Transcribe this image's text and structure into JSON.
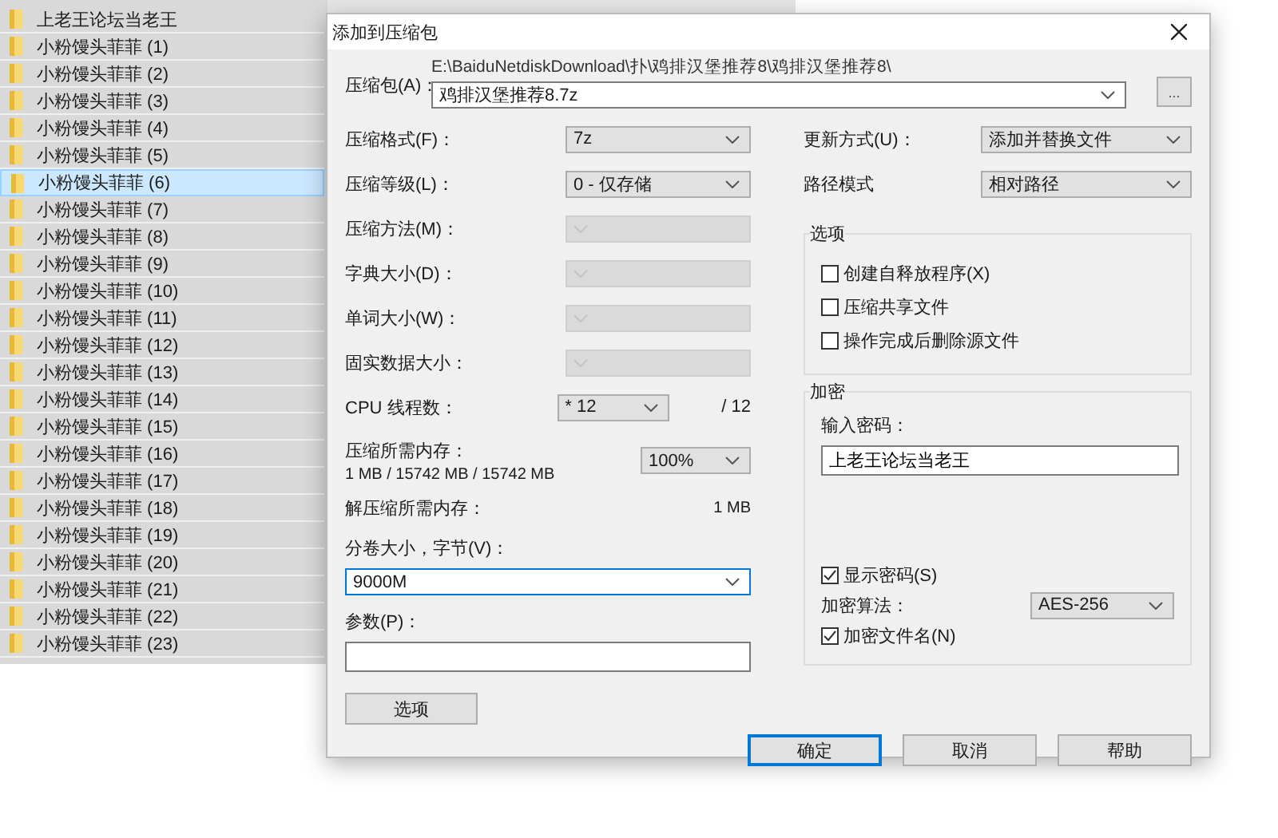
{
  "file_list": {
    "items": [
      {
        "name": "上老王论坛当老王",
        "selected": false
      },
      {
        "name": "小粉馒头菲菲 (1)",
        "selected": false
      },
      {
        "name": "小粉馒头菲菲 (2)",
        "selected": false
      },
      {
        "name": "小粉馒头菲菲 (3)",
        "selected": false
      },
      {
        "name": "小粉馒头菲菲 (4)",
        "selected": false
      },
      {
        "name": "小粉馒头菲菲 (5)",
        "selected": false
      },
      {
        "name": "小粉馒头菲菲 (6)",
        "selected": true
      },
      {
        "name": "小粉馒头菲菲 (7)",
        "selected": false
      },
      {
        "name": "小粉馒头菲菲 (8)",
        "selected": false
      },
      {
        "name": "小粉馒头菲菲 (9)",
        "selected": false
      },
      {
        "name": "小粉馒头菲菲 (10)",
        "selected": false
      },
      {
        "name": "小粉馒头菲菲 (11)",
        "selected": false
      },
      {
        "name": "小粉馒头菲菲 (12)",
        "selected": false
      },
      {
        "name": "小粉馒头菲菲 (13)",
        "selected": false
      },
      {
        "name": "小粉馒头菲菲 (14)",
        "selected": false
      },
      {
        "name": "小粉馒头菲菲 (15)",
        "selected": false
      },
      {
        "name": "小粉馒头菲菲 (16)",
        "selected": false
      },
      {
        "name": "小粉馒头菲菲 (17)",
        "selected": false
      },
      {
        "name": "小粉馒头菲菲 (18)",
        "selected": false
      },
      {
        "name": "小粉馒头菲菲 (19)",
        "selected": false
      },
      {
        "name": "小粉馒头菲菲 (20)",
        "selected": false
      },
      {
        "name": "小粉馒头菲菲 (21)",
        "selected": false
      },
      {
        "name": "小粉馒头菲菲 (22)",
        "selected": false
      },
      {
        "name": "小粉馒头菲菲 (23)",
        "selected": false
      }
    ]
  },
  "dialog": {
    "title": "添加到压缩包",
    "archive": {
      "label": "压缩包(A)：",
      "path": "E:\\BaiduNetdiskDownload\\扑\\鸡排汉堡推荐8\\鸡排汉堡推荐8\\",
      "value": "鸡排汉堡推荐8.7z",
      "browse": "..."
    },
    "left_fields": [
      {
        "label": "压缩格式(F)：",
        "value": "7z",
        "disabled": false
      },
      {
        "label": "压缩等级(L)：",
        "value": "0 - 仅存储",
        "disabled": false
      },
      {
        "label": "压缩方法(M)：",
        "disabled": true
      },
      {
        "label": "字典大小(D)：",
        "disabled": true
      },
      {
        "label": "单词大小(W)：",
        "disabled": true
      },
      {
        "label": "固实数据大小：",
        "disabled": true
      }
    ],
    "cpu_threads": {
      "label": "CPU 线程数：",
      "value": "* 12",
      "max": "/ 12"
    },
    "memory": {
      "label": "压缩所需内存：",
      "detail": "1 MB / 15742 MB / 15742 MB",
      "value": "100%"
    },
    "decompress_memory": {
      "label": "解压缩所需内存：",
      "value": "1 MB"
    },
    "volume": {
      "label": "分卷大小，字节(V)：",
      "value": "9000M"
    },
    "params": {
      "label": "参数(P)："
    },
    "options_button": "选项",
    "right_fields": [
      {
        "label": "更新方式(U)：",
        "value": "添加并替换文件"
      },
      {
        "label": "路径模式",
        "value": "相对路径"
      }
    ],
    "options_group": {
      "title": "选项",
      "checkboxes": [
        {
          "label": "创建自释放程序(X)",
          "checked": false
        },
        {
          "label": "压缩共享文件",
          "checked": false
        },
        {
          "label": "操作完成后删除源文件",
          "checked": false
        }
      ]
    },
    "encryption": {
      "title": "加密",
      "password_label": "输入密码：",
      "password": "上老王论坛当老王",
      "show_password": {
        "label": "显示密码(S)",
        "checked": true
      },
      "method_label": "加密算法：",
      "method": "AES-256",
      "encrypt_names": {
        "label": "加密文件名(N)",
        "checked": true
      }
    },
    "buttons": [
      {
        "label": "确定",
        "default": true
      },
      {
        "label": "取消",
        "default": false
      },
      {
        "label": "帮助",
        "default": false
      }
    ]
  }
}
